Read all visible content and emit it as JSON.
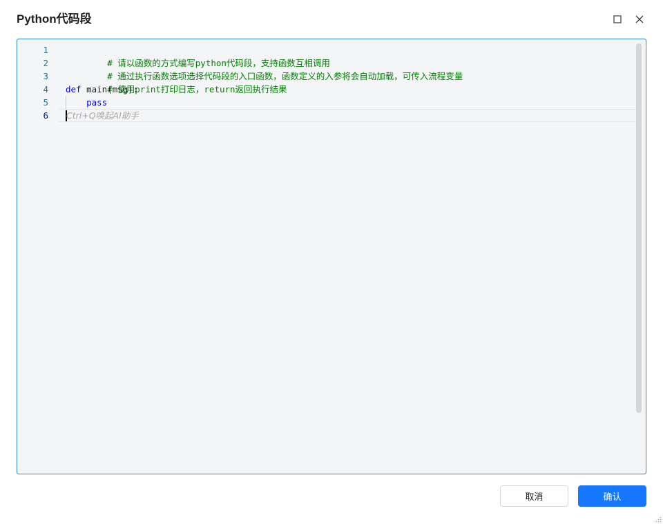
{
  "dialog": {
    "title": "Python代码段",
    "maximize_icon": "maximize-icon",
    "close_icon": "close-icon"
  },
  "editor": {
    "lines": [
      {
        "number": "1",
        "text": "# 请以函数的方式编写python代码段，支持函数互相调用",
        "kind": "comment"
      },
      {
        "number": "2",
        "text": "# 通过执行函数选项选择代码段的入口函数，函数定义的入参将会自动加载，可传入流程变量",
        "kind": "comment"
      },
      {
        "number": "3",
        "text": "# 使用print打印日志，return返回执行结果",
        "kind": "comment"
      },
      {
        "number": "4",
        "keyword": "def",
        "rest": " main(msg):",
        "kind": "code"
      },
      {
        "number": "5",
        "indent": "    ",
        "keyword": "pass",
        "kind": "code"
      },
      {
        "number": "6",
        "kind": "active"
      }
    ],
    "ai_hint": "Ctrl+Q唤起AI助手"
  },
  "footer": {
    "cancel_label": "取消",
    "ok_label": "确认"
  },
  "colors": {
    "accent": "#1677ff",
    "editor_border": "#2f7fd6",
    "comment": "#008000",
    "keyword": "#0000ff",
    "line_number": "#237893"
  }
}
